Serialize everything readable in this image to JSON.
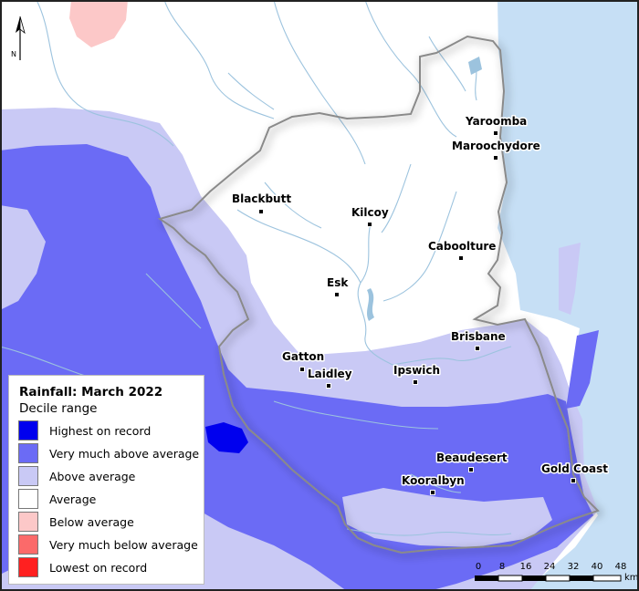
{
  "map": {
    "north_label": "N",
    "towns": [
      {
        "name": "Yaroomba"
      },
      {
        "name": "Maroochydore"
      },
      {
        "name": "Blackbutt"
      },
      {
        "name": "Kilcoy"
      },
      {
        "name": "Caboolture"
      },
      {
        "name": "Esk"
      },
      {
        "name": "Brisbane"
      },
      {
        "name": "Gatton"
      },
      {
        "name": "Laidley"
      },
      {
        "name": "Ipswich"
      },
      {
        "name": "Beaudesert"
      },
      {
        "name": "Gold Coast"
      },
      {
        "name": "Kooralbyn"
      }
    ]
  },
  "legend": {
    "title": "Rainfall: March 2022",
    "subtitle": "Decile range",
    "items": [
      {
        "label": "Highest on record",
        "color": "#0000ee"
      },
      {
        "label": "Very much above average",
        "color": "#6b6bf5"
      },
      {
        "label": "Above average",
        "color": "#c9c9f5"
      },
      {
        "label": "Average",
        "color": "#ffffff"
      },
      {
        "label": "Below average",
        "color": "#fcc8c8"
      },
      {
        "label": "Very much below average",
        "color": "#fb6a6a"
      },
      {
        "label": "Lowest on record",
        "color": "#ff2020"
      }
    ]
  },
  "scale": {
    "ticks": [
      "0",
      "8",
      "16",
      "24",
      "32",
      "40",
      "48"
    ],
    "unit": "km"
  },
  "colors": {
    "ocean": "#c6dff5",
    "rivers": "#9cc3de",
    "boundary": "#8a8a8a"
  }
}
